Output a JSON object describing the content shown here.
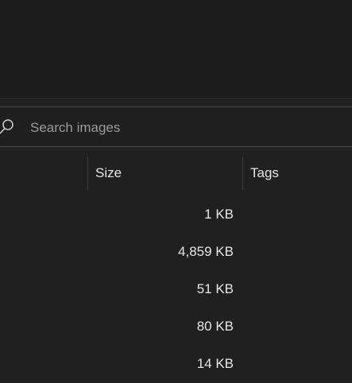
{
  "search": {
    "placeholder": "Search images",
    "icon": "search-icon"
  },
  "table": {
    "columns": [
      {
        "label": "Size"
      },
      {
        "label": "Tags"
      }
    ],
    "rows": [
      {
        "size": "1 KB",
        "tags": ""
      },
      {
        "size": "4,859 KB",
        "tags": ""
      },
      {
        "size": "51 KB",
        "tags": ""
      },
      {
        "size": "80 KB",
        "tags": ""
      },
      {
        "size": "14 KB",
        "tags": ""
      }
    ]
  },
  "colors": {
    "background": "#202020",
    "top_area": "#1c1c1c",
    "text": "#e6e6e6",
    "placeholder": "#9b9b9b",
    "border": "#4a4a4a"
  }
}
